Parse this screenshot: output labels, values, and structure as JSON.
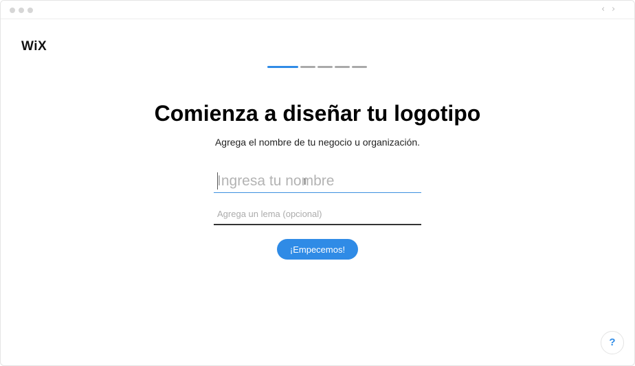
{
  "window": {
    "back_glyph": "‹",
    "forward_glyph": "›"
  },
  "brand": {
    "logo_text": "WiX"
  },
  "progress": {
    "total_steps": 5,
    "current_step": 1,
    "active_color": "#2f8be6",
    "inactive_color": "#a9a9a9"
  },
  "main": {
    "title": "Comienza a diseñar tu logotipo",
    "subtitle": "Agrega el nombre de tu negocio u organización.",
    "name_input": {
      "value": "",
      "placeholder": "Ingresa tu nombre"
    },
    "motto_input": {
      "value": "",
      "placeholder": "Agrega un lema (opcional)"
    },
    "submit_label": "¡Empecemos!",
    "accent_color": "#2f8be6"
  },
  "help": {
    "label": "?"
  }
}
